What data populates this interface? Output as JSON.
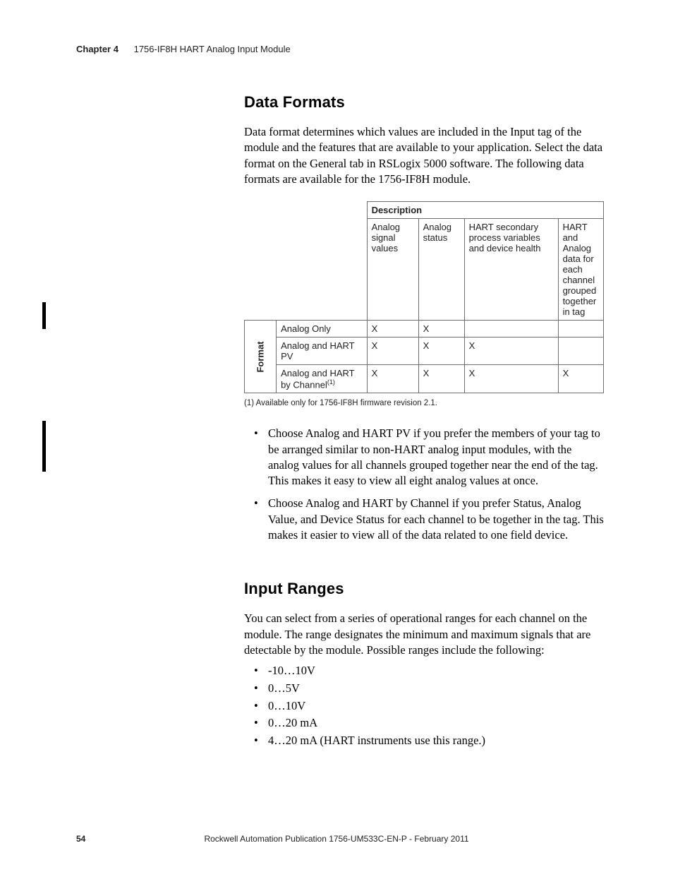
{
  "header": {
    "chapter": "Chapter 4",
    "title": "1756-IF8H HART Analog Input Module"
  },
  "section1": {
    "heading": "Data Formats",
    "para": "Data format determines which values are included in the Input tag of the module and the features that are available to your application. Select the data format on the General tab in RSLogix 5000 software. The following data formats are available for the 1756-IF8H module."
  },
  "table": {
    "desc_header": "Description",
    "cols": [
      "Analog signal values",
      "Analog status",
      "HART secondary process variables and device health",
      "HART and Analog data for each channel grouped together in tag"
    ],
    "row_label": "Format",
    "rows": [
      {
        "name": "Analog Only",
        "cells": [
          "X",
          "X",
          "",
          ""
        ],
        "sup": ""
      },
      {
        "name": "Analog and HART PV",
        "cells": [
          "X",
          "X",
          "X",
          ""
        ],
        "sup": ""
      },
      {
        "name": "Analog and HART by Channel",
        "cells": [
          "X",
          "X",
          "X",
          "X"
        ],
        "sup": "(1)"
      }
    ],
    "footnote": "(1)  Available only for 1756-IF8H firmware revision 2.1."
  },
  "bullets_after_table": [
    "Choose Analog and HART PV if you prefer the members of your tag to be arranged similar to non-HART analog input modules, with the analog values for all channels grouped together near the end of the tag. This makes it easy to view all eight analog values at once.",
    "Choose Analog and HART by Channel if you prefer Status, Analog Value, and Device Status for each channel to be together in the tag. This makes it easier to view all of the data related to one field device."
  ],
  "section2": {
    "heading": "Input Ranges",
    "para": "You can select from a series of operational ranges for each channel on the module. The range designates the minimum and maximum signals that are detectable by the module. Possible ranges include the following:",
    "ranges": [
      "-10…10V",
      "0…5V",
      "0…10V",
      "0…20 mA",
      "4…20 mA (HART instruments use this range.)"
    ]
  },
  "footer": {
    "page": "54",
    "publication": "Rockwell Automation Publication 1756-UM533C-EN-P - February 2011"
  }
}
